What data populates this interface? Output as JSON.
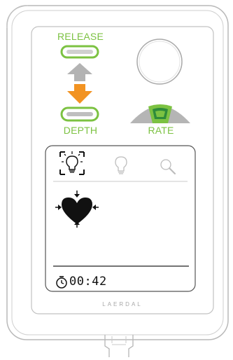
{
  "device": {
    "brand": "LAERDAL",
    "accent_green": "#7cc242",
    "accent_orange": "#f29322"
  },
  "panel": {
    "release_label": "RELEASE",
    "depth_label": "DEPTH",
    "rate_label": "RATE",
    "depth_indicator": "arrow-down-active"
  },
  "screen": {
    "tabs": [
      {
        "icon": "lightbulb-icon",
        "selected": true
      },
      {
        "icon": "lightbulb-outline-icon",
        "selected": false
      },
      {
        "icon": "magnifier-icon",
        "selected": false
      }
    ],
    "status_icon": "heart-compression-icon",
    "timer": {
      "icon": "stopwatch-icon",
      "value": "00:42"
    }
  }
}
